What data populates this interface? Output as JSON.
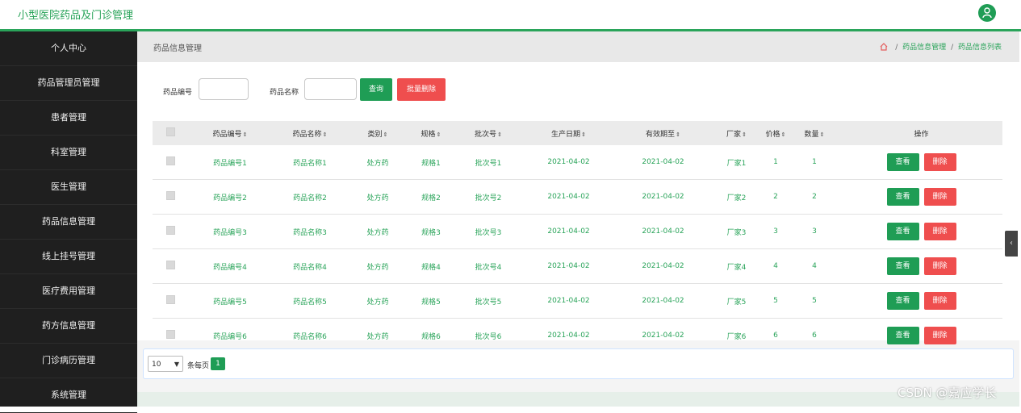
{
  "app": {
    "title": "小型医院药品及门诊管理"
  },
  "sidebar": {
    "items": [
      {
        "label": "个人中心"
      },
      {
        "label": "药品管理员管理"
      },
      {
        "label": "患者管理"
      },
      {
        "label": "科室管理"
      },
      {
        "label": "医生管理"
      },
      {
        "label": "药品信息管理"
      },
      {
        "label": "线上挂号管理"
      },
      {
        "label": "医疗费用管理"
      },
      {
        "label": "药方信息管理"
      },
      {
        "label": "门诊病历管理"
      },
      {
        "label": "系统管理"
      }
    ]
  },
  "page": {
    "title": "药品信息管理",
    "breadcrumb": [
      "药品信息管理",
      "药品信息列表"
    ],
    "breadcrumb_sep": "/"
  },
  "search": {
    "code_label": "药品编号",
    "name_label": "药品名称",
    "query_button": "查询",
    "batch_delete_button": "批量删除"
  },
  "table": {
    "headers": [
      "药品编号",
      "药品名称",
      "类别",
      "规格",
      "批次号",
      "生产日期",
      "有效期至",
      "厂家",
      "价格",
      "数量",
      "操作"
    ],
    "sort_glyph": "⇕",
    "rows": [
      [
        "药品编号1",
        "药品名称1",
        "处方药",
        "规格1",
        "批次号1",
        "2021-04-02",
        "2021-04-02",
        "厂家1",
        "1",
        "1"
      ],
      [
        "药品编号2",
        "药品名称2",
        "处方药",
        "规格2",
        "批次号2",
        "2021-04-02",
        "2021-04-02",
        "厂家2",
        "2",
        "2"
      ],
      [
        "药品编号3",
        "药品名称3",
        "处方药",
        "规格3",
        "批次号3",
        "2021-04-02",
        "2021-04-02",
        "厂家3",
        "3",
        "3"
      ],
      [
        "药品编号4",
        "药品名称4",
        "处方药",
        "规格4",
        "批次号4",
        "2021-04-02",
        "2021-04-02",
        "厂家4",
        "4",
        "4"
      ],
      [
        "药品编号5",
        "药品名称5",
        "处方药",
        "规格5",
        "批次号5",
        "2021-04-02",
        "2021-04-02",
        "厂家5",
        "5",
        "5"
      ],
      [
        "药品编号6",
        "药品名称6",
        "处方药",
        "规格6",
        "批次号6",
        "2021-04-02",
        "2021-04-02",
        "厂家6",
        "6",
        "6"
      ]
    ],
    "view_label": "查看",
    "delete_label": "删除"
  },
  "pager": {
    "page_size": "10",
    "per_page_label": "条每页",
    "current_page": "1"
  },
  "watermark": "CSDN @嘉应学长",
  "colors": {
    "accent": "#1f9d55",
    "danger": "#ef4e4e",
    "sidebar": "#1f1f1f"
  }
}
